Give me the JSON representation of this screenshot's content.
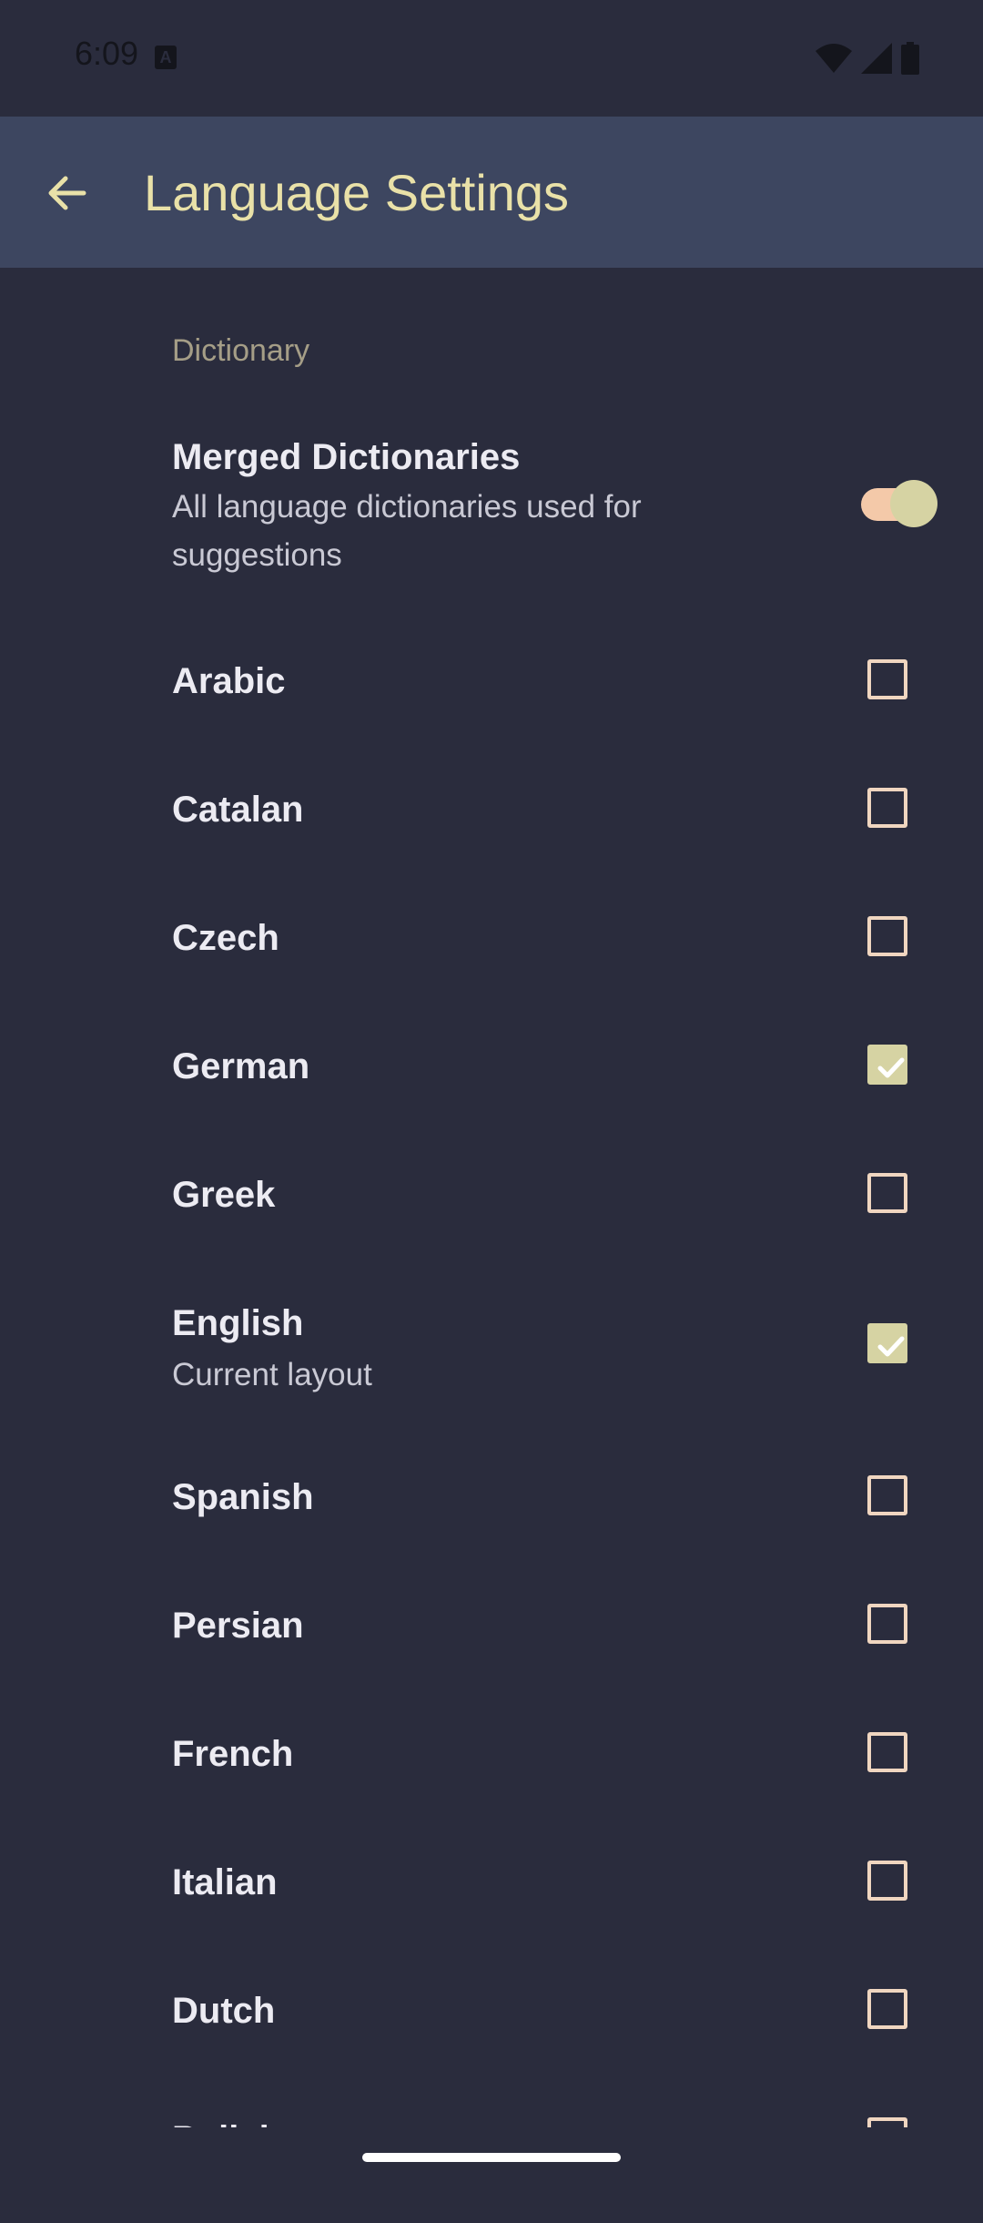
{
  "status_bar": {
    "time": "6:09"
  },
  "app_bar": {
    "title": "Language Settings"
  },
  "section": {
    "label": "Dictionary"
  },
  "merged": {
    "title": "Merged Dictionaries",
    "summary": "All language dictionaries used for suggestions",
    "enabled": true
  },
  "languages": [
    {
      "label": "Arabic",
      "checked": false
    },
    {
      "label": "Catalan",
      "checked": false
    },
    {
      "label": "Czech",
      "checked": false
    },
    {
      "label": "German",
      "checked": true
    },
    {
      "label": "Greek",
      "checked": false
    },
    {
      "label": "English",
      "summary": "Current layout",
      "checked": true
    },
    {
      "label": "Spanish",
      "checked": false
    },
    {
      "label": "Persian",
      "checked": false
    },
    {
      "label": "French",
      "checked": false
    },
    {
      "label": "Italian",
      "checked": false
    },
    {
      "label": "Dutch",
      "checked": false
    },
    {
      "label": "Polish",
      "checked": false
    }
  ],
  "colors": {
    "background": "#2a2c3d",
    "app_bar": "#3d4660",
    "accent": "#e9e1a8",
    "checkbox_border": "#f0d6c0",
    "checkbox_checked": "#d6d3a3"
  }
}
